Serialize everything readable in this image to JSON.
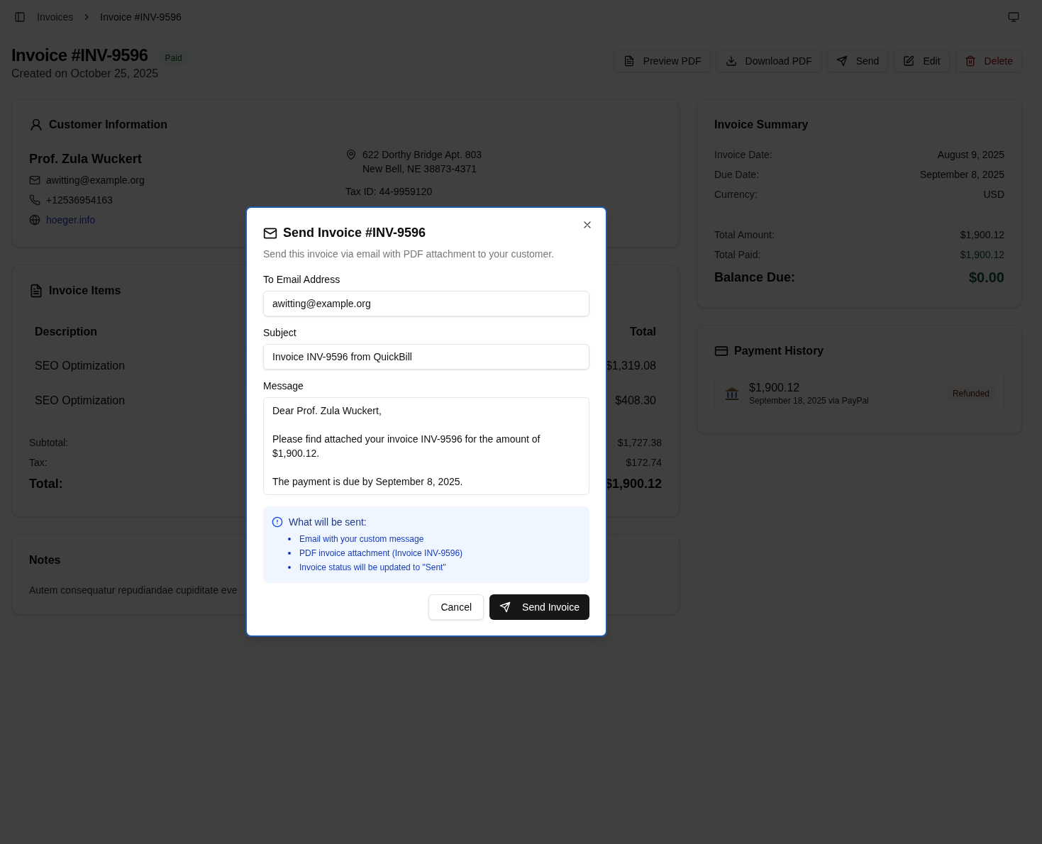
{
  "breadcrumb": [
    {
      "label": "Invoices"
    },
    {
      "label": "Invoice #INV-9596"
    }
  ],
  "header": {
    "title": "Invoice #INV-9596",
    "status": "Paid",
    "created": "Created on October 25, 2025"
  },
  "actions": [
    {
      "label": "Preview PDF",
      "kind": "preview"
    },
    {
      "label": "Download PDF",
      "kind": "download"
    },
    {
      "label": "Send",
      "kind": "send"
    },
    {
      "label": "Edit",
      "kind": "edit"
    },
    {
      "label": "Delete",
      "kind": "delete"
    }
  ],
  "customer": {
    "heading": "Customer Information",
    "name": "Prof. Zula Wuckert",
    "email": "awitting@example.org",
    "phone": "+12536954163",
    "website": "hoeger.info",
    "address_lines": [
      "622 Dorthy Bridge Apt. 803",
      "New Bell, NE 38873-4371"
    ],
    "tax_id": "Tax ID: 44-9959120"
  },
  "items": {
    "heading": "Invoice Items",
    "columns": [
      "Description",
      "Total"
    ],
    "rows": [
      {
        "description": "SEO Optimization",
        "total": "$1,319.08"
      },
      {
        "description": "SEO Optimization",
        "total": "$408.30"
      }
    ],
    "totals": [
      {
        "label": "Subtotal:",
        "value": "$1,727.38",
        "kind": "normal"
      },
      {
        "label": "Tax:",
        "value": "$172.74",
        "kind": "normal"
      },
      {
        "label": "Total:",
        "value": "$1,900.12",
        "kind": "grand"
      }
    ]
  },
  "notes": {
    "heading": "Notes",
    "text": "Autem consequatur repudiandae cupiditate eve"
  },
  "summary": {
    "heading": "Invoice Summary",
    "details": [
      {
        "label": "Invoice Date:",
        "value": "August 9, 2025",
        "kind": "plain"
      },
      {
        "label": "Due Date:",
        "value": "September 8, 2025",
        "kind": "plain"
      },
      {
        "label": "Currency:",
        "value": "USD",
        "kind": "plain"
      }
    ],
    "totals": [
      {
        "label": "Total Amount:",
        "value": "$1,900.12",
        "kind": "plain"
      },
      {
        "label": "Total Paid:",
        "value": "$1,900.12",
        "kind": "paid"
      },
      {
        "label": "Balance Due:",
        "value": "$0.00",
        "kind": "balance"
      }
    ]
  },
  "payment_history": {
    "heading": "Payment History",
    "payments": [
      {
        "amount": "$1,900.12",
        "detail": "September 18, 2025 via PayPal",
        "status": "Refunded"
      }
    ]
  },
  "dialog": {
    "title": "Send Invoice #INV-9596",
    "description": "Send this invoice via email with PDF attachment to your customer.",
    "fields": [
      {
        "label": "To Email Address",
        "value": "awitting@example.org",
        "kind": "input"
      },
      {
        "label": "Subject",
        "value": "Invoice INV-9596 from QuickBill",
        "kind": "input"
      },
      {
        "label": "Message",
        "value": "Dear Prof. Zula Wuckert,\n\nPlease find attached your invoice INV-9596 for the amount of $1,900.12.\n\nThe payment is due by September 8, 2025.",
        "kind": "textarea"
      }
    ],
    "info": {
      "heading": "What will be sent:",
      "items": [
        "Email with your custom message",
        "PDF invoice attachment (Invoice INV-9596)",
        "Invoice status will be updated to \"Sent\""
      ]
    },
    "buttons": [
      {
        "label": "Cancel",
        "kind": "secondary"
      },
      {
        "label": "Send Invoice",
        "kind": "primary"
      }
    ]
  }
}
